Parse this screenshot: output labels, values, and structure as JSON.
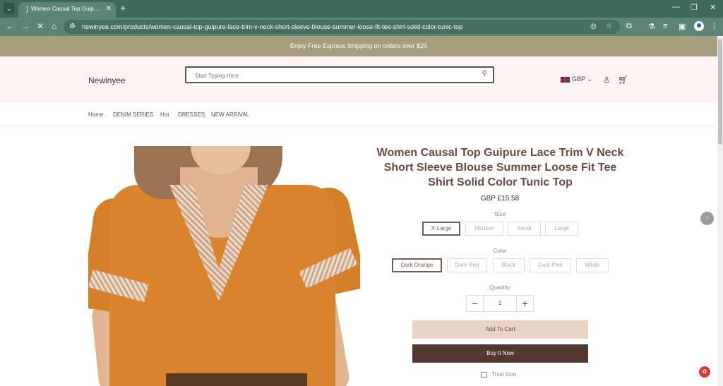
{
  "browser": {
    "tab_title": "Women Causal Top Guipure La",
    "tab_favicon": "loading-icon",
    "url": "newinyee.com/products/women-causal-top-guipure-lace-trim-v-neck-short-sleeve-blouse-summer-loose-fit-tee-shirt-solid-color-tunic-top"
  },
  "announcement": "Enjoy Free Express Shipping on orders over $29",
  "header": {
    "logo": "Newinyee",
    "search_placeholder": "Start Typing Here",
    "currency": "GBP"
  },
  "nav": {
    "items": [
      "Home",
      "DENIM SERIES",
      "Hot",
      "DRESSES",
      "NEW ARRIVAL"
    ]
  },
  "product": {
    "title": "Women Causal Top Guipure Lace Trim V Neck Short Sleeve Blouse Summer Loose Fit Tee Shirt Solid Color Tunic Top",
    "price": "GBP £15.58",
    "size_label": "Size",
    "sizes": [
      "X-Large",
      "Medium",
      "Small",
      "Large"
    ],
    "selected_size": "X-Large",
    "color_label": "Color",
    "colors": [
      "Dark Orange",
      "Dark Red",
      "Black",
      "Dark Pink",
      "White"
    ],
    "selected_color": "Dark Orange",
    "quantity_label": "Quantity",
    "quantity": "1",
    "add_to_cart": "Add To Cart",
    "buy_now": "Buy It Now",
    "trust": "Trust Icon"
  },
  "colors": {
    "chrome": "#3f6a5a",
    "announce_bg": "#a69e7c",
    "header_bg": "#fdf4f1",
    "title_color": "#6b4a3a",
    "cart_btn": "#e9d5c8",
    "buy_btn": "#523a31"
  }
}
